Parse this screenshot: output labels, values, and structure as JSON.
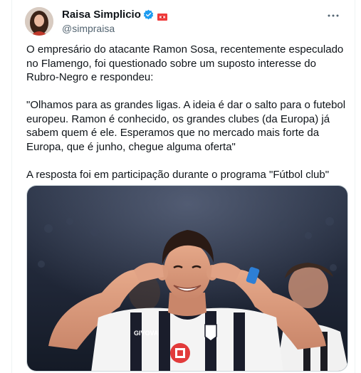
{
  "author": {
    "name": "Raisa Simplicio",
    "handle": "@simpraisa"
  },
  "icons": {
    "verified": "verified-badge-icon",
    "flag": "flag-icon",
    "more": "more-options-icon"
  },
  "tweet": {
    "paragraphs": [
      "O empresário do atacante Ramon Sosa, recentemente especulado no Flamengo, foi questionado sobre um suposto interesse do Rubro-Negro e respondeu:",
      "\"Olhamos para as grandes ligas. A ideia é dar o salto para o futebol europeu. Ramon é conhecido, os grandes clubes (da Europa) já sabem quem é ele. Esperamos que no mercado mais forte da Europa, que é junho, chegue alguma oferta\"",
      "A resposta foi em participação durante o programa \"Fútbol club\""
    ]
  },
  "media": {
    "jersey_sponsor": "GIVOVA"
  },
  "colors": {
    "accent": "#1d9bf0",
    "text": "#0f1419",
    "secondary": "#536471",
    "border": "#cfd9de"
  }
}
